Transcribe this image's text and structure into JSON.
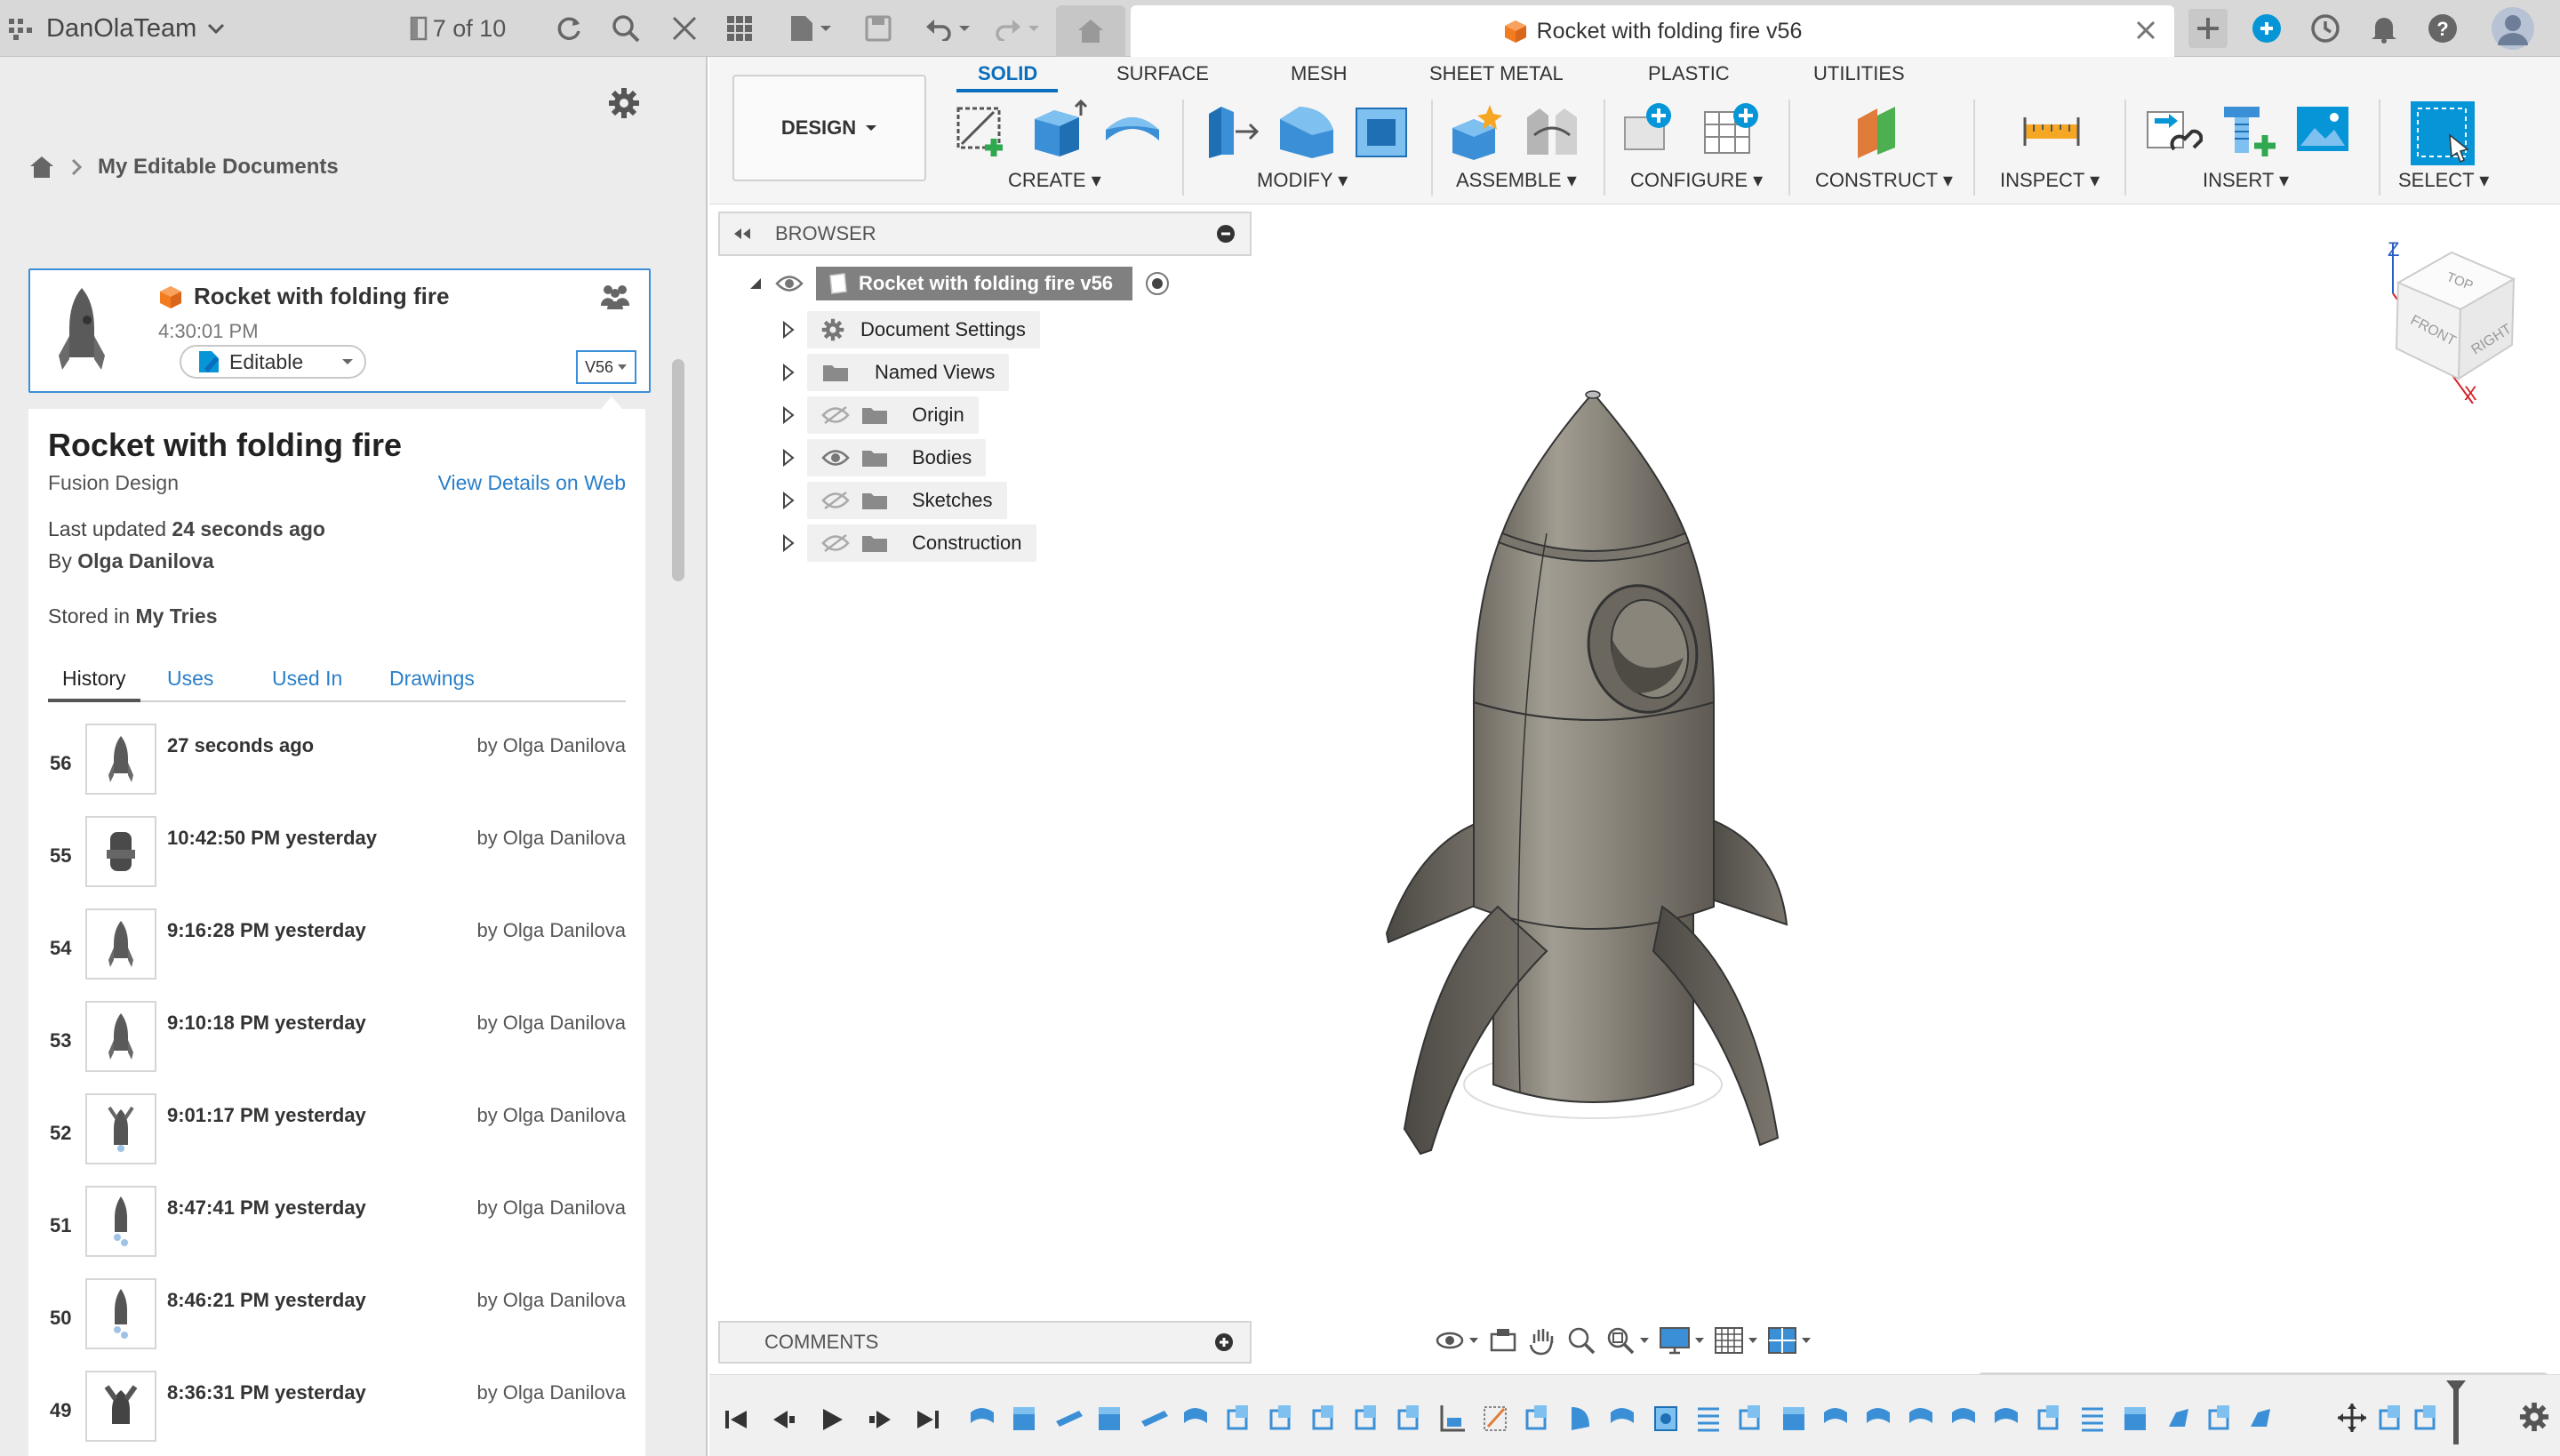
{
  "top_bar": {
    "team_name": "DanOlaTeam",
    "version_counter": "7 of 10",
    "document_tab_title": "Rocket with folding fire v56"
  },
  "left_panel": {
    "breadcrumb": "My Editable Documents",
    "card": {
      "title": "Rocket with folding fire",
      "time": "4:30:01 PM",
      "status": "Editable",
      "version": "V56"
    },
    "details": {
      "title": "Rocket with folding fire",
      "subtitle": "Fusion Design",
      "view_link": "View Details on Web",
      "last_updated_label": "Last updated",
      "last_updated_value": "24 seconds ago",
      "by_label": "By",
      "by_value": "Olga Danilova",
      "stored_label": "Stored in",
      "stored_value": "My Tries"
    },
    "tabs": [
      "History",
      "Uses",
      "Used In",
      "Drawings"
    ],
    "history": [
      {
        "num": "56",
        "time": "27 seconds ago",
        "by": "by Olga Danilova"
      },
      {
        "num": "55",
        "time": "10:42:50 PM yesterday",
        "by": "by Olga Danilova"
      },
      {
        "num": "54",
        "time": "9:16:28 PM yesterday",
        "by": "by Olga Danilova"
      },
      {
        "num": "53",
        "time": "9:10:18 PM yesterday",
        "by": "by Olga Danilova"
      },
      {
        "num": "52",
        "time": "9:01:17 PM yesterday",
        "by": "by Olga Danilova"
      },
      {
        "num": "51",
        "time": "8:47:41 PM yesterday",
        "by": "by Olga Danilova"
      },
      {
        "num": "50",
        "time": "8:46:21 PM yesterday",
        "by": "by Olga Danilova"
      },
      {
        "num": "49",
        "time": "8:36:31 PM yesterday",
        "by": "by Olga Danilova"
      }
    ]
  },
  "toolbar": {
    "workspace": "DESIGN",
    "tabs": [
      "SOLID",
      "SURFACE",
      "MESH",
      "SHEET METAL",
      "PLASTIC",
      "UTILITIES"
    ],
    "groups": [
      "CREATE",
      "MODIFY",
      "ASSEMBLE",
      "CONFIGURE",
      "CONSTRUCT",
      "INSPECT",
      "INSERT",
      "SELECT"
    ]
  },
  "browser": {
    "header": "BROWSER",
    "root": "Rocket with folding fire v56",
    "items": [
      "Document Settings",
      "Named Views",
      "Origin",
      "Bodies",
      "Sketches",
      "Construction"
    ]
  },
  "comments": {
    "label": "COMMENTS"
  },
  "view_cube": {
    "top": "TOP",
    "front": "FRONT",
    "right": "RIGHT",
    "z": "Z",
    "x": "X"
  },
  "colors": {
    "accent": "#0696d7",
    "active_tab": "#0a6ebd",
    "card_border": "#3a8fd9",
    "orange": "#f47c20"
  }
}
